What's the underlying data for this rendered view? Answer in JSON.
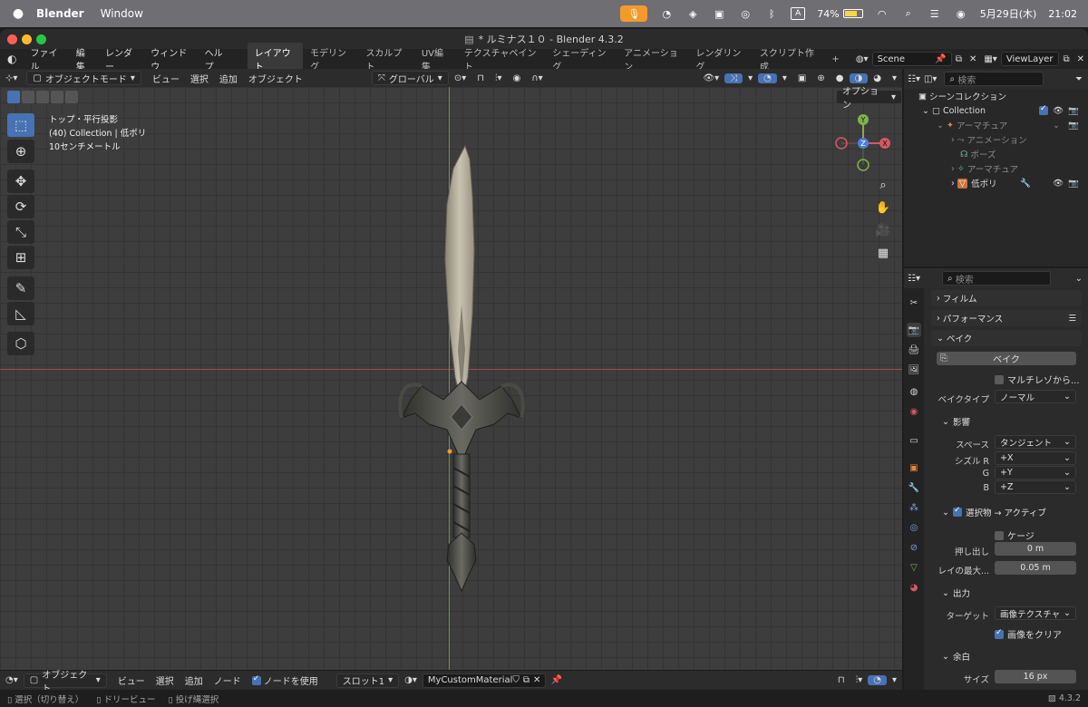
{
  "menubar": {
    "app_name": "Blender",
    "menu_window": "Window",
    "input_mode": "A",
    "battery": "74%",
    "battery_level": 0.74,
    "datetime": "5月29日(木)",
    "time": "21:02"
  },
  "window": {
    "title": "* ルミナス１０ - Blender 4.3.2"
  },
  "topbar": {
    "menus": [
      "ファイル",
      "編集",
      "レンダー",
      "ウィンドウ",
      "ヘルプ"
    ],
    "workspaces": [
      "レイアウト",
      "モデリング",
      "スカルプト",
      "UV編集",
      "テクスチャペイント",
      "シェーディング",
      "アニメーション",
      "レンダリング",
      "スクリプト作成"
    ],
    "add_tab": "+",
    "scene": "Scene",
    "view_layer": "ViewLayer"
  },
  "viewport_header": {
    "mode": "オブジェクトモード",
    "menus": [
      "ビュー",
      "選択",
      "追加",
      "オブジェクト"
    ],
    "orientation": "グローバル",
    "options": "オプション"
  },
  "viewport": {
    "view_name": "トップ・平行投影",
    "collection_info": "(40) Collection | 低ポリ",
    "scale_info": "10センチメートル",
    "gizmo": {
      "y": "Y",
      "z": "Z",
      "x": "X"
    }
  },
  "outliner": {
    "search_placeholder": "検索",
    "scene_collection": "シーンコレクション",
    "rows": [
      {
        "label": "Collection"
      },
      {
        "label": "アーマチュア"
      },
      {
        "label": "アニメーション"
      },
      {
        "label": "ポーズ"
      },
      {
        "label": "アーマチュア"
      },
      {
        "label": "低ポリ"
      }
    ]
  },
  "properties": {
    "search_placeholder": "検索",
    "film": "フィルム",
    "performance": "パフォーマンス",
    "bake": "ベイク",
    "bake_button": "ベイク",
    "multires": "マルチレゾから...",
    "bake_type_label": "ベイクタイプ",
    "bake_type": "ノーマル",
    "influence": "影響",
    "space_label": "スペース",
    "space": "タンジェント",
    "swizzle_r_label": "シズル R",
    "swizzle_r": "+X",
    "g_label": "G",
    "swizzle_g": "+Y",
    "b_label": "B",
    "swizzle_b": "+Z",
    "selected_to_active": "選択物 → アクティブ",
    "cage": "ケージ",
    "extrusion_label": "押し出し",
    "extrusion": "0 m",
    "ray_label": "レイの最大...",
    "ray": "0.05 m",
    "output": "出力",
    "target_label": "ターゲット",
    "target": "画像テクスチャ",
    "clear_image": "画像をクリア",
    "margin": "余白",
    "size_label": "サイズ",
    "size": "16 px"
  },
  "bottom_header": {
    "mode": "オブジェクト",
    "menus": [
      "ビュー",
      "選択",
      "追加",
      "ノード"
    ],
    "use_nodes": "ノードを使用",
    "slot": "スロット1",
    "material": "MyCustomMaterial"
  },
  "statusbar": {
    "items": [
      "選択（切り替え）",
      "ドリービュー",
      "投げ縄選択"
    ],
    "version": "4.3.2"
  }
}
